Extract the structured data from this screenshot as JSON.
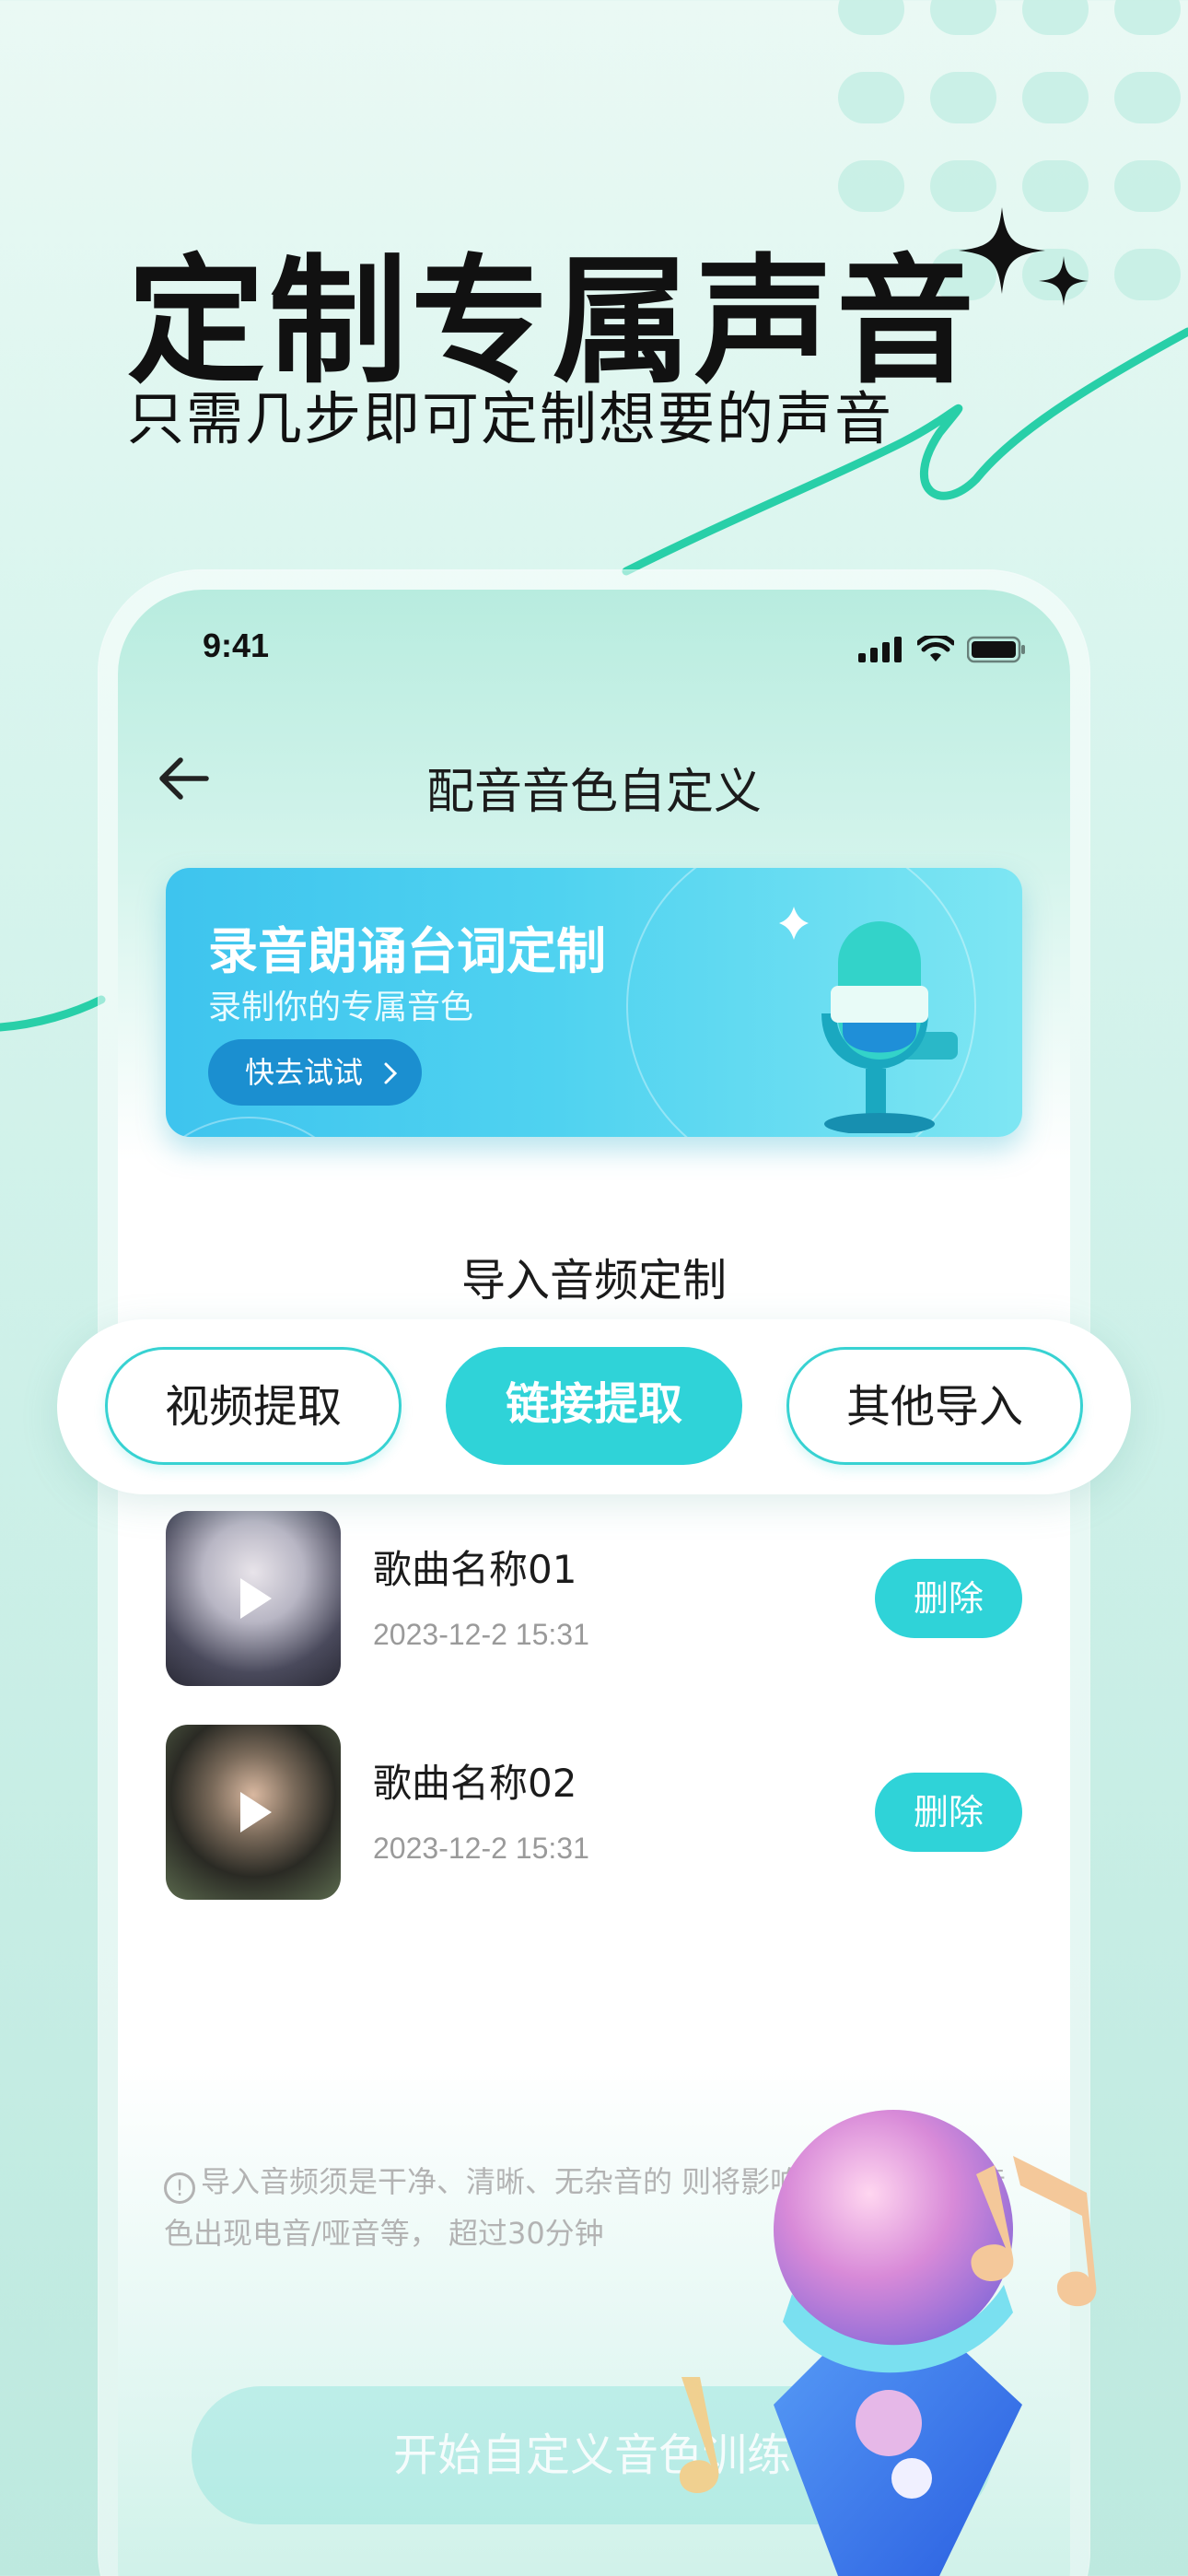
{
  "hero": {
    "title": "定制专属声音",
    "subtitle": "只需几步即可定制想要的声音"
  },
  "status_bar": {
    "time": "9:41"
  },
  "nav": {
    "title": "配音音色自定义"
  },
  "banner": {
    "title": "录音朗诵台词定制",
    "subtitle": "录制你的专属音色",
    "button": "快去试试"
  },
  "section": {
    "title": "导入音频定制"
  },
  "tabs": [
    {
      "label": "视频提取",
      "active": false
    },
    {
      "label": "链接提取",
      "active": true
    },
    {
      "label": "其他导入",
      "active": false
    }
  ],
  "songs": [
    {
      "name": "歌曲名称01",
      "time": "2023-12-2 15:31",
      "delete_label": "删除"
    },
    {
      "name": "歌曲名称02",
      "time": "2023-12-2 15:31",
      "delete_label": "删除"
    }
  ],
  "notice": {
    "icon": "!",
    "text": "导入音频须是干净、清晰、无杂音的                    则将影响合成效果导致音色出现电音/哑音等，                超过30分钟"
  },
  "start_button": {
    "label": "开始自定义音色训练"
  },
  "colors": {
    "accent": "#2fd3d8",
    "banner_start": "#3ec4ee",
    "banner_button": "#1b8fd0",
    "wave_line": "#28cfa8"
  }
}
